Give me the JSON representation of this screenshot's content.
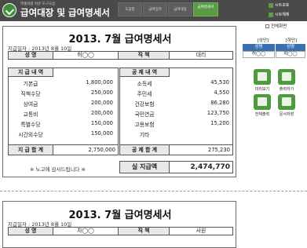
{
  "header": {
    "subtitle": "엑셀처럼 쉬운 도구모음",
    "title": "급여대장 및 급여명세서",
    "tabs": [
      "도움말",
      "급여입력",
      "급여대장",
      "급여명세서"
    ],
    "buttons": [
      "시트보호",
      "시트해제"
    ]
  },
  "slip": {
    "title": "2013. 7월 급여명세서",
    "payday_label": "지급일자 : 2013년 8월 10일",
    "name_label": "성 명",
    "name_value": "허◯◯",
    "position_label": "직 책",
    "position_value": "대리",
    "pay_header": "지 급 내 역",
    "deduct_header": "공 제 내 역",
    "pay_items": [
      {
        "label": "기본급",
        "value": "1,800,000"
      },
      {
        "label": "직책수당",
        "value": "250,000"
      },
      {
        "label": "상여금",
        "value": "200,000"
      },
      {
        "label": "교통비",
        "value": "200,000"
      },
      {
        "label": "특별수당",
        "value": "150,000"
      },
      {
        "label": "시간외수당",
        "value": "150,000"
      }
    ],
    "deduct_items": [
      {
        "label": "소득세",
        "value": "45,530"
      },
      {
        "label": "주민세",
        "value": "4,550"
      },
      {
        "label": "건강보험",
        "value": "86,280"
      },
      {
        "label": "국민연금",
        "value": "123,750"
      },
      {
        "label": "고용보험",
        "value": "15,200"
      },
      {
        "label": "기타",
        "value": ""
      }
    ],
    "pay_total_label": "지 급 합 계",
    "pay_total_value": "2,750,000",
    "deduct_total_label": "공 제 합 계",
    "deduct_total_value": "275,230",
    "thanks": "※ 노고에 감사드립니다 ※",
    "net_label": "실 지급액",
    "net_value": "2,474,770"
  },
  "slip2": {
    "title": "2013. 7월 급여명세서",
    "payday_label": "지급일자 : 2013년 8월 10일",
    "name_label": "성 명",
    "name_value": "차◯◯",
    "position_label": "직 책",
    "position_value": "사원"
  },
  "panel": {
    "checkbox_label": "전체화면",
    "upper_label": "[상단]",
    "lower_label": "[하단]",
    "upper_head": "성명",
    "lower_head": "성명",
    "upper_value": "허◯◯",
    "lower_value": "차◯◯",
    "buttons": [
      "미리보기",
      "출력하기",
      "전체출력",
      "문서저장"
    ]
  },
  "colors": {
    "header_bg": "#4a4a4a",
    "accent_green": "#5a9b45",
    "select_blue": "#3a6fb0"
  }
}
